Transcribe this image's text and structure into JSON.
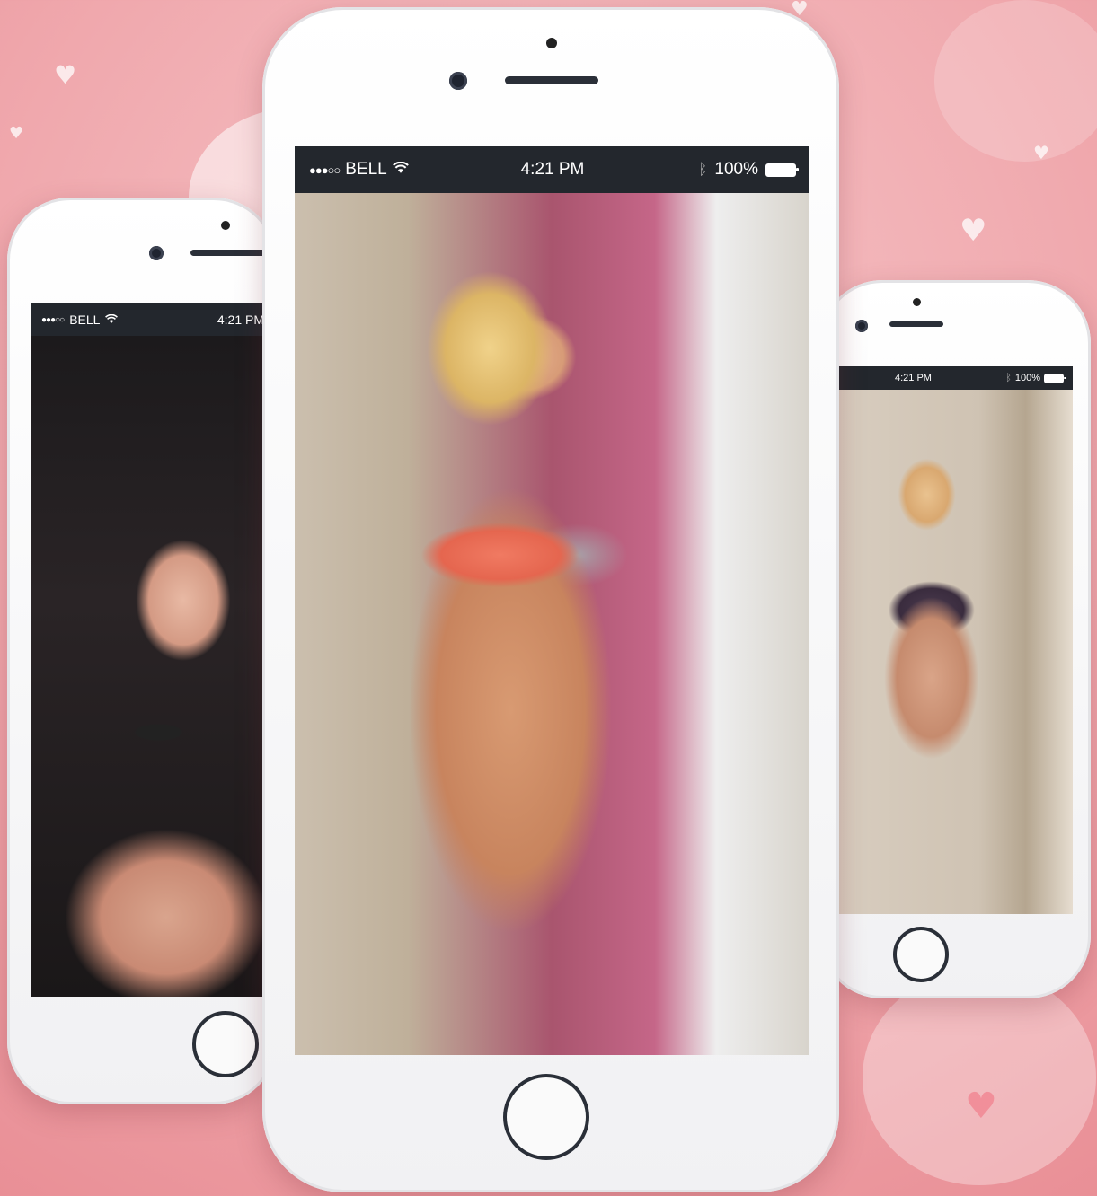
{
  "phones": {
    "left": {
      "carrier": "BELL",
      "signal": "●●●○○",
      "time": "4:21 PM",
      "wifi_icon": "wifi-icon"
    },
    "center": {
      "carrier": "BELL",
      "signal": "●●●○○",
      "time": "4:21 PM",
      "battery": "100%",
      "battery_level": 1.0,
      "bluetooth_icon": "bluetooth-icon"
    },
    "right": {
      "time": "4:21 PM",
      "battery": "100%",
      "battery_level": 1.0,
      "bluetooth_icon": "bluetooth-icon"
    }
  },
  "colors": {
    "background": "#f0a9ae",
    "statusbar": "#23272d",
    "phone_body": "#ffffff"
  }
}
